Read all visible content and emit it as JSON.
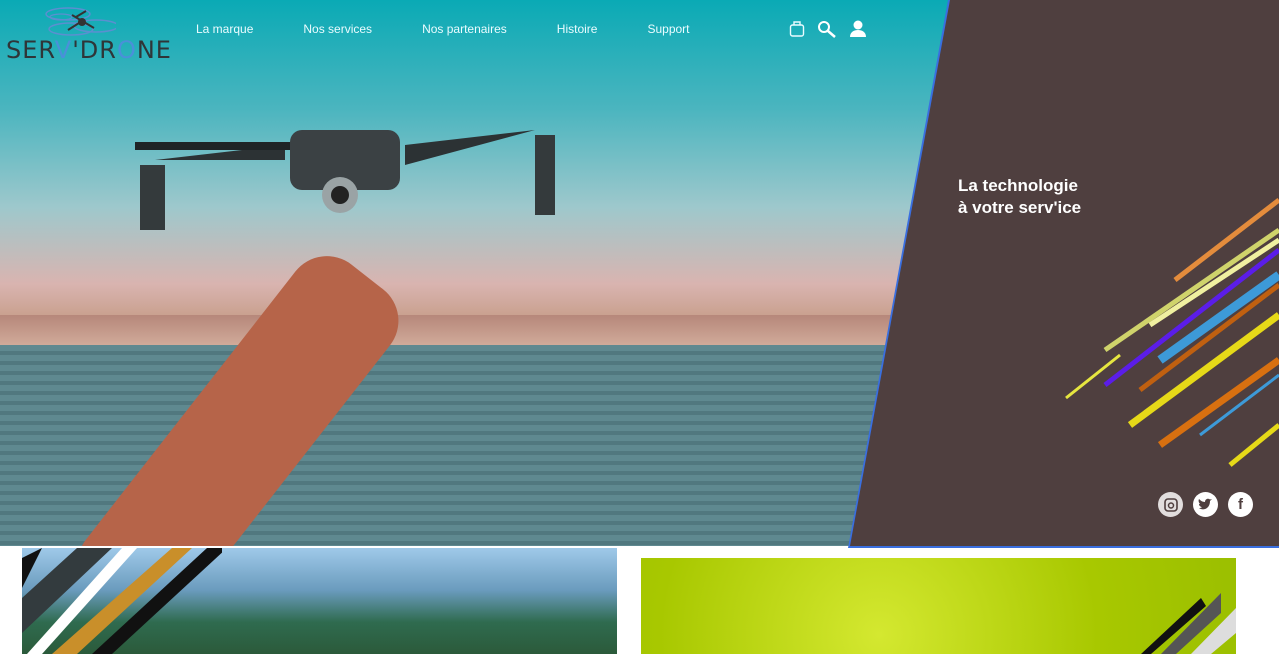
{
  "brand": {
    "logo_text_1": "SER",
    "logo_text_v": "V",
    "logo_text_2": "'DR",
    "logo_text_o": "O",
    "logo_text_3": "NE"
  },
  "nav": {
    "items": [
      {
        "label": "La marque"
      },
      {
        "label": "Nos services"
      },
      {
        "label": "Nos partenaires"
      },
      {
        "label": "Histoire"
      },
      {
        "label": "Support"
      }
    ]
  },
  "header_icons": [
    "shopping-bag-icon",
    "search-icon",
    "user-icon"
  ],
  "hero": {
    "tagline_line1": "La technologie",
    "tagline_line2": "à votre serv'ice"
  },
  "social": {
    "instagram": "instagram-icon",
    "twitter": "twitter-icon",
    "facebook": "f"
  },
  "colors": {
    "panel": "#4f3f3f",
    "accent_blue": "#3a6fe0",
    "logo_blue": "#4a90d9",
    "nav_text": "#eafcff"
  }
}
